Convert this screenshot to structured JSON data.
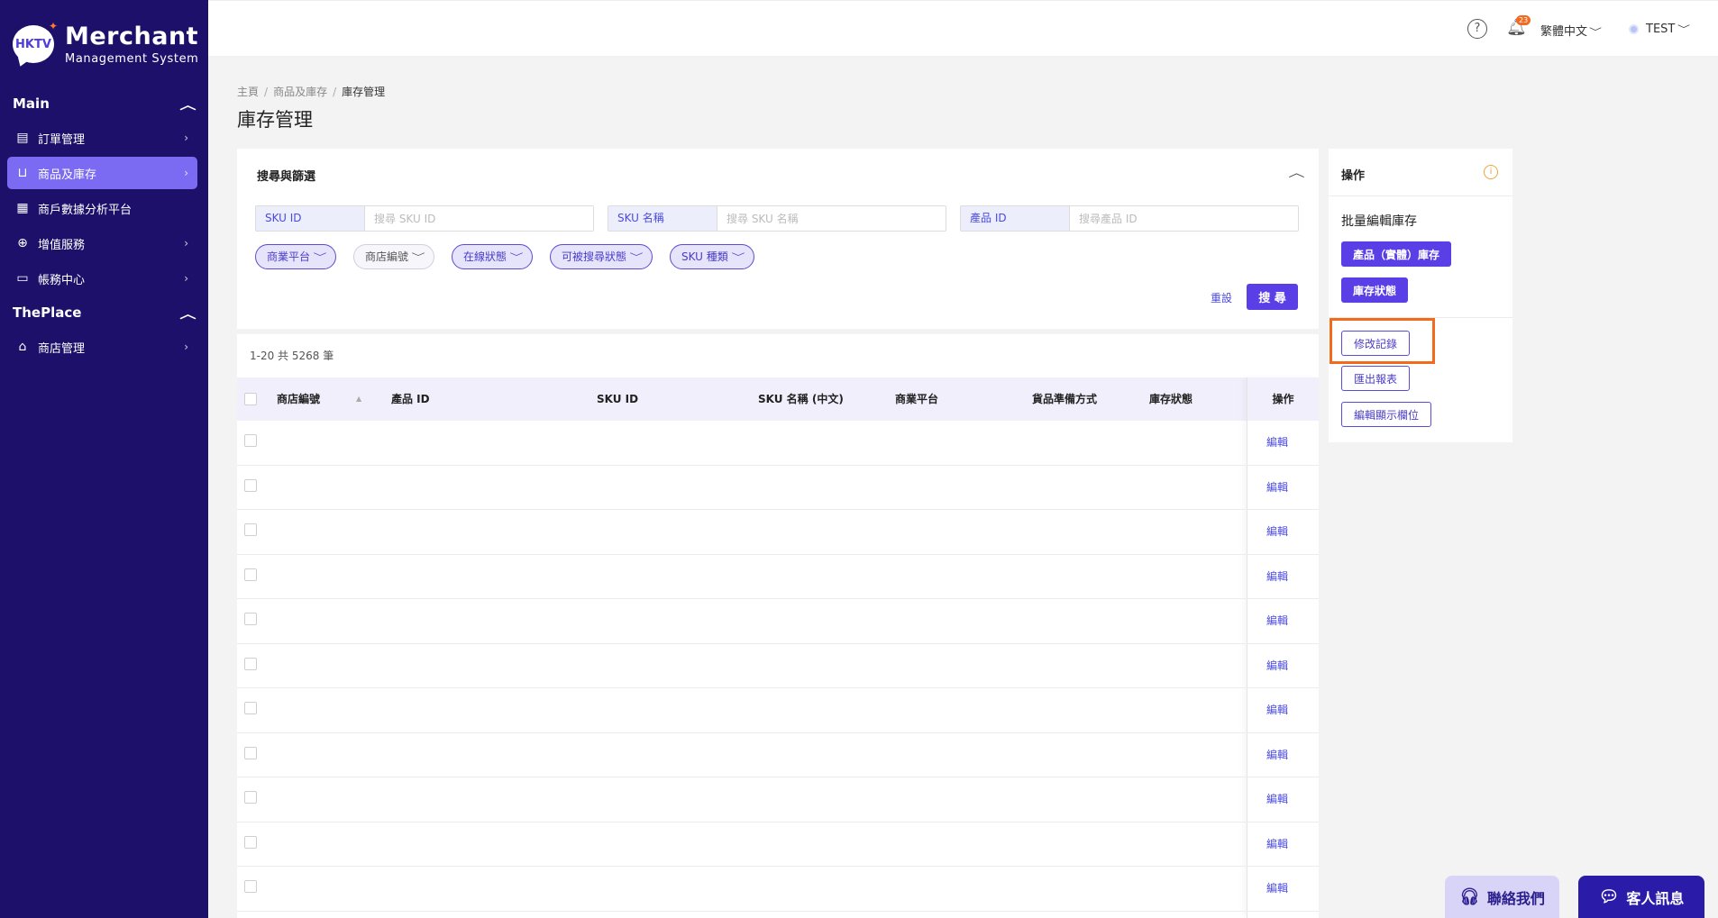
{
  "brand": {
    "logo": "HKTV",
    "title": "Merchant",
    "subtitle": "Management System"
  },
  "sidebar": {
    "main_label": "Main",
    "main_items": [
      {
        "label": "訂單管理",
        "icon": "order-icon"
      },
      {
        "label": "商品及庫存",
        "icon": "bag-icon"
      },
      {
        "label": "商戶數據分析平台",
        "icon": "grid-icon"
      },
      {
        "label": "增值服務",
        "icon": "plus-circle-icon"
      },
      {
        "label": "帳務中心",
        "icon": "card-icon"
      }
    ],
    "theplace_label": "ThePlace",
    "theplace_items": [
      {
        "label": "商店管理",
        "icon": "store-icon"
      }
    ]
  },
  "topbar": {
    "notification_count": "23",
    "language": "繁體中文",
    "user": "TEST"
  },
  "breadcrumb": {
    "home": "主頁",
    "parent": "商品及庫存",
    "current": "庫存管理"
  },
  "page_title": "庫存管理",
  "filter": {
    "title": "搜尋與篩選",
    "fields": [
      {
        "label": "SKU ID",
        "placeholder": "搜尋 SKU ID"
      },
      {
        "label": "SKU 名稱",
        "placeholder": "搜尋 SKU 名稱"
      },
      {
        "label": "產品 ID",
        "placeholder": "搜尋產品 ID"
      }
    ],
    "pills": [
      "商業平台",
      "商店編號",
      "在線狀態",
      "可被搜尋狀態",
      "SKU 種類"
    ],
    "reset": "重設",
    "search": "搜 尋"
  },
  "table": {
    "count": "1-20 共 5268 筆",
    "columns": [
      "商店編號",
      "產品 ID",
      "SKU ID",
      "SKU 名稱 (中文)",
      "商業平台",
      "貨品準備方式",
      "庫存狀態"
    ],
    "op_header": "操作",
    "edit_label": "編輯"
  },
  "ops": {
    "title": "操作",
    "bulk_title": "批量編輯庫存",
    "btn_product_stock": "產品（實體）庫存",
    "btn_stock_status": "庫存狀態",
    "btn_change_log": "修改記錄",
    "btn_export": "匯出報表",
    "btn_edit_columns": "編輯顯示欄位"
  },
  "floating": {
    "contact": "聯絡我們",
    "chat": "客人訊息"
  },
  "colors": {
    "sidebar": "#1d106a",
    "accent": "#5b3fe6",
    "highlight": "#f26a1b"
  }
}
